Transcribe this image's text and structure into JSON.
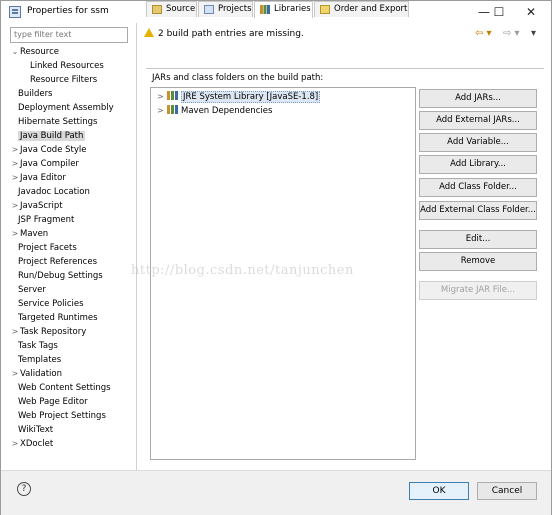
{
  "window": {
    "title": "Properties for ssm",
    "minimize": "—",
    "maximize": "☐",
    "close": "✕"
  },
  "filter": {
    "placeholder": "type filter text"
  },
  "tree": [
    {
      "label": "Resource",
      "toggle": "⌄",
      "indent": 0
    },
    {
      "label": "Linked Resources",
      "toggle": "",
      "indent": 2
    },
    {
      "label": "Resource Filters",
      "toggle": "",
      "indent": 2
    },
    {
      "label": "Builders",
      "toggle": "",
      "indent": 1
    },
    {
      "label": "Deployment Assembly",
      "toggle": "",
      "indent": 1
    },
    {
      "label": "Hibernate Settings",
      "toggle": "",
      "indent": 1
    },
    {
      "label": "Java Build Path",
      "toggle": "",
      "indent": 1,
      "selected": true
    },
    {
      "label": "Java Code Style",
      "toggle": ">",
      "indent": 0
    },
    {
      "label": "Java Compiler",
      "toggle": ">",
      "indent": 0
    },
    {
      "label": "Java Editor",
      "toggle": ">",
      "indent": 0
    },
    {
      "label": "Javadoc Location",
      "toggle": "",
      "indent": 1
    },
    {
      "label": "JavaScript",
      "toggle": ">",
      "indent": 0
    },
    {
      "label": "JSP Fragment",
      "toggle": "",
      "indent": 1
    },
    {
      "label": "Maven",
      "toggle": ">",
      "indent": 0
    },
    {
      "label": "Project Facets",
      "toggle": "",
      "indent": 1
    },
    {
      "label": "Project References",
      "toggle": "",
      "indent": 1
    },
    {
      "label": "Run/Debug Settings",
      "toggle": "",
      "indent": 1
    },
    {
      "label": "Server",
      "toggle": "",
      "indent": 1
    },
    {
      "label": "Service Policies",
      "toggle": "",
      "indent": 1
    },
    {
      "label": "Targeted Runtimes",
      "toggle": "",
      "indent": 1
    },
    {
      "label": "Task Repository",
      "toggle": ">",
      "indent": 0
    },
    {
      "label": "Task Tags",
      "toggle": "",
      "indent": 1
    },
    {
      "label": "Templates",
      "toggle": "",
      "indent": 1
    },
    {
      "label": "Validation",
      "toggle": ">",
      "indent": 0
    },
    {
      "label": "Web Content Settings",
      "toggle": "",
      "indent": 1
    },
    {
      "label": "Web Page Editor",
      "toggle": "",
      "indent": 1
    },
    {
      "label": "Web Project Settings",
      "toggle": "",
      "indent": 1
    },
    {
      "label": "WikiText",
      "toggle": "",
      "indent": 1
    },
    {
      "label": "XDoclet",
      "toggle": ">",
      "indent": 0
    }
  ],
  "message": "2 build path entries are missing.",
  "nav": {
    "back": "⇦ ▾",
    "forward": "⇨ ▾",
    "menu": "▾"
  },
  "tabs": [
    {
      "label": "Source",
      "active": false
    },
    {
      "label": "Projects",
      "active": false
    },
    {
      "label": "Libraries",
      "active": true
    },
    {
      "label": "Order and Export",
      "active": false
    }
  ],
  "panel_title": "JARs and class folders on the build path:",
  "entries": [
    {
      "label": "JRE System Library [JavaSE-1.8]",
      "toggle": ">",
      "selected": true
    },
    {
      "label": "Maven Dependencies",
      "toggle": ">",
      "selected": false
    }
  ],
  "buttons": [
    {
      "label": "Add JARs...",
      "enabled": true
    },
    {
      "label": "Add External JARs...",
      "enabled": true
    },
    {
      "label": "Add Variable...",
      "enabled": true
    },
    {
      "label": "Add Library...",
      "enabled": true
    },
    {
      "label": "Add Class Folder...",
      "enabled": true
    },
    {
      "label": "Add External Class Folder...",
      "enabled": true
    },
    {
      "label": "Edit...",
      "enabled": true
    },
    {
      "label": "Remove",
      "enabled": true
    },
    {
      "label": "Migrate JAR File...",
      "enabled": false
    }
  ],
  "watermark": "http://blog.csdn.net/tanjunchen",
  "footer": {
    "help": "?",
    "ok": "OK",
    "cancel": "Cancel"
  },
  "colors": {
    "accent": "#3c7fb1",
    "warning": "#e8b000",
    "selection": "#dde7f3"
  }
}
